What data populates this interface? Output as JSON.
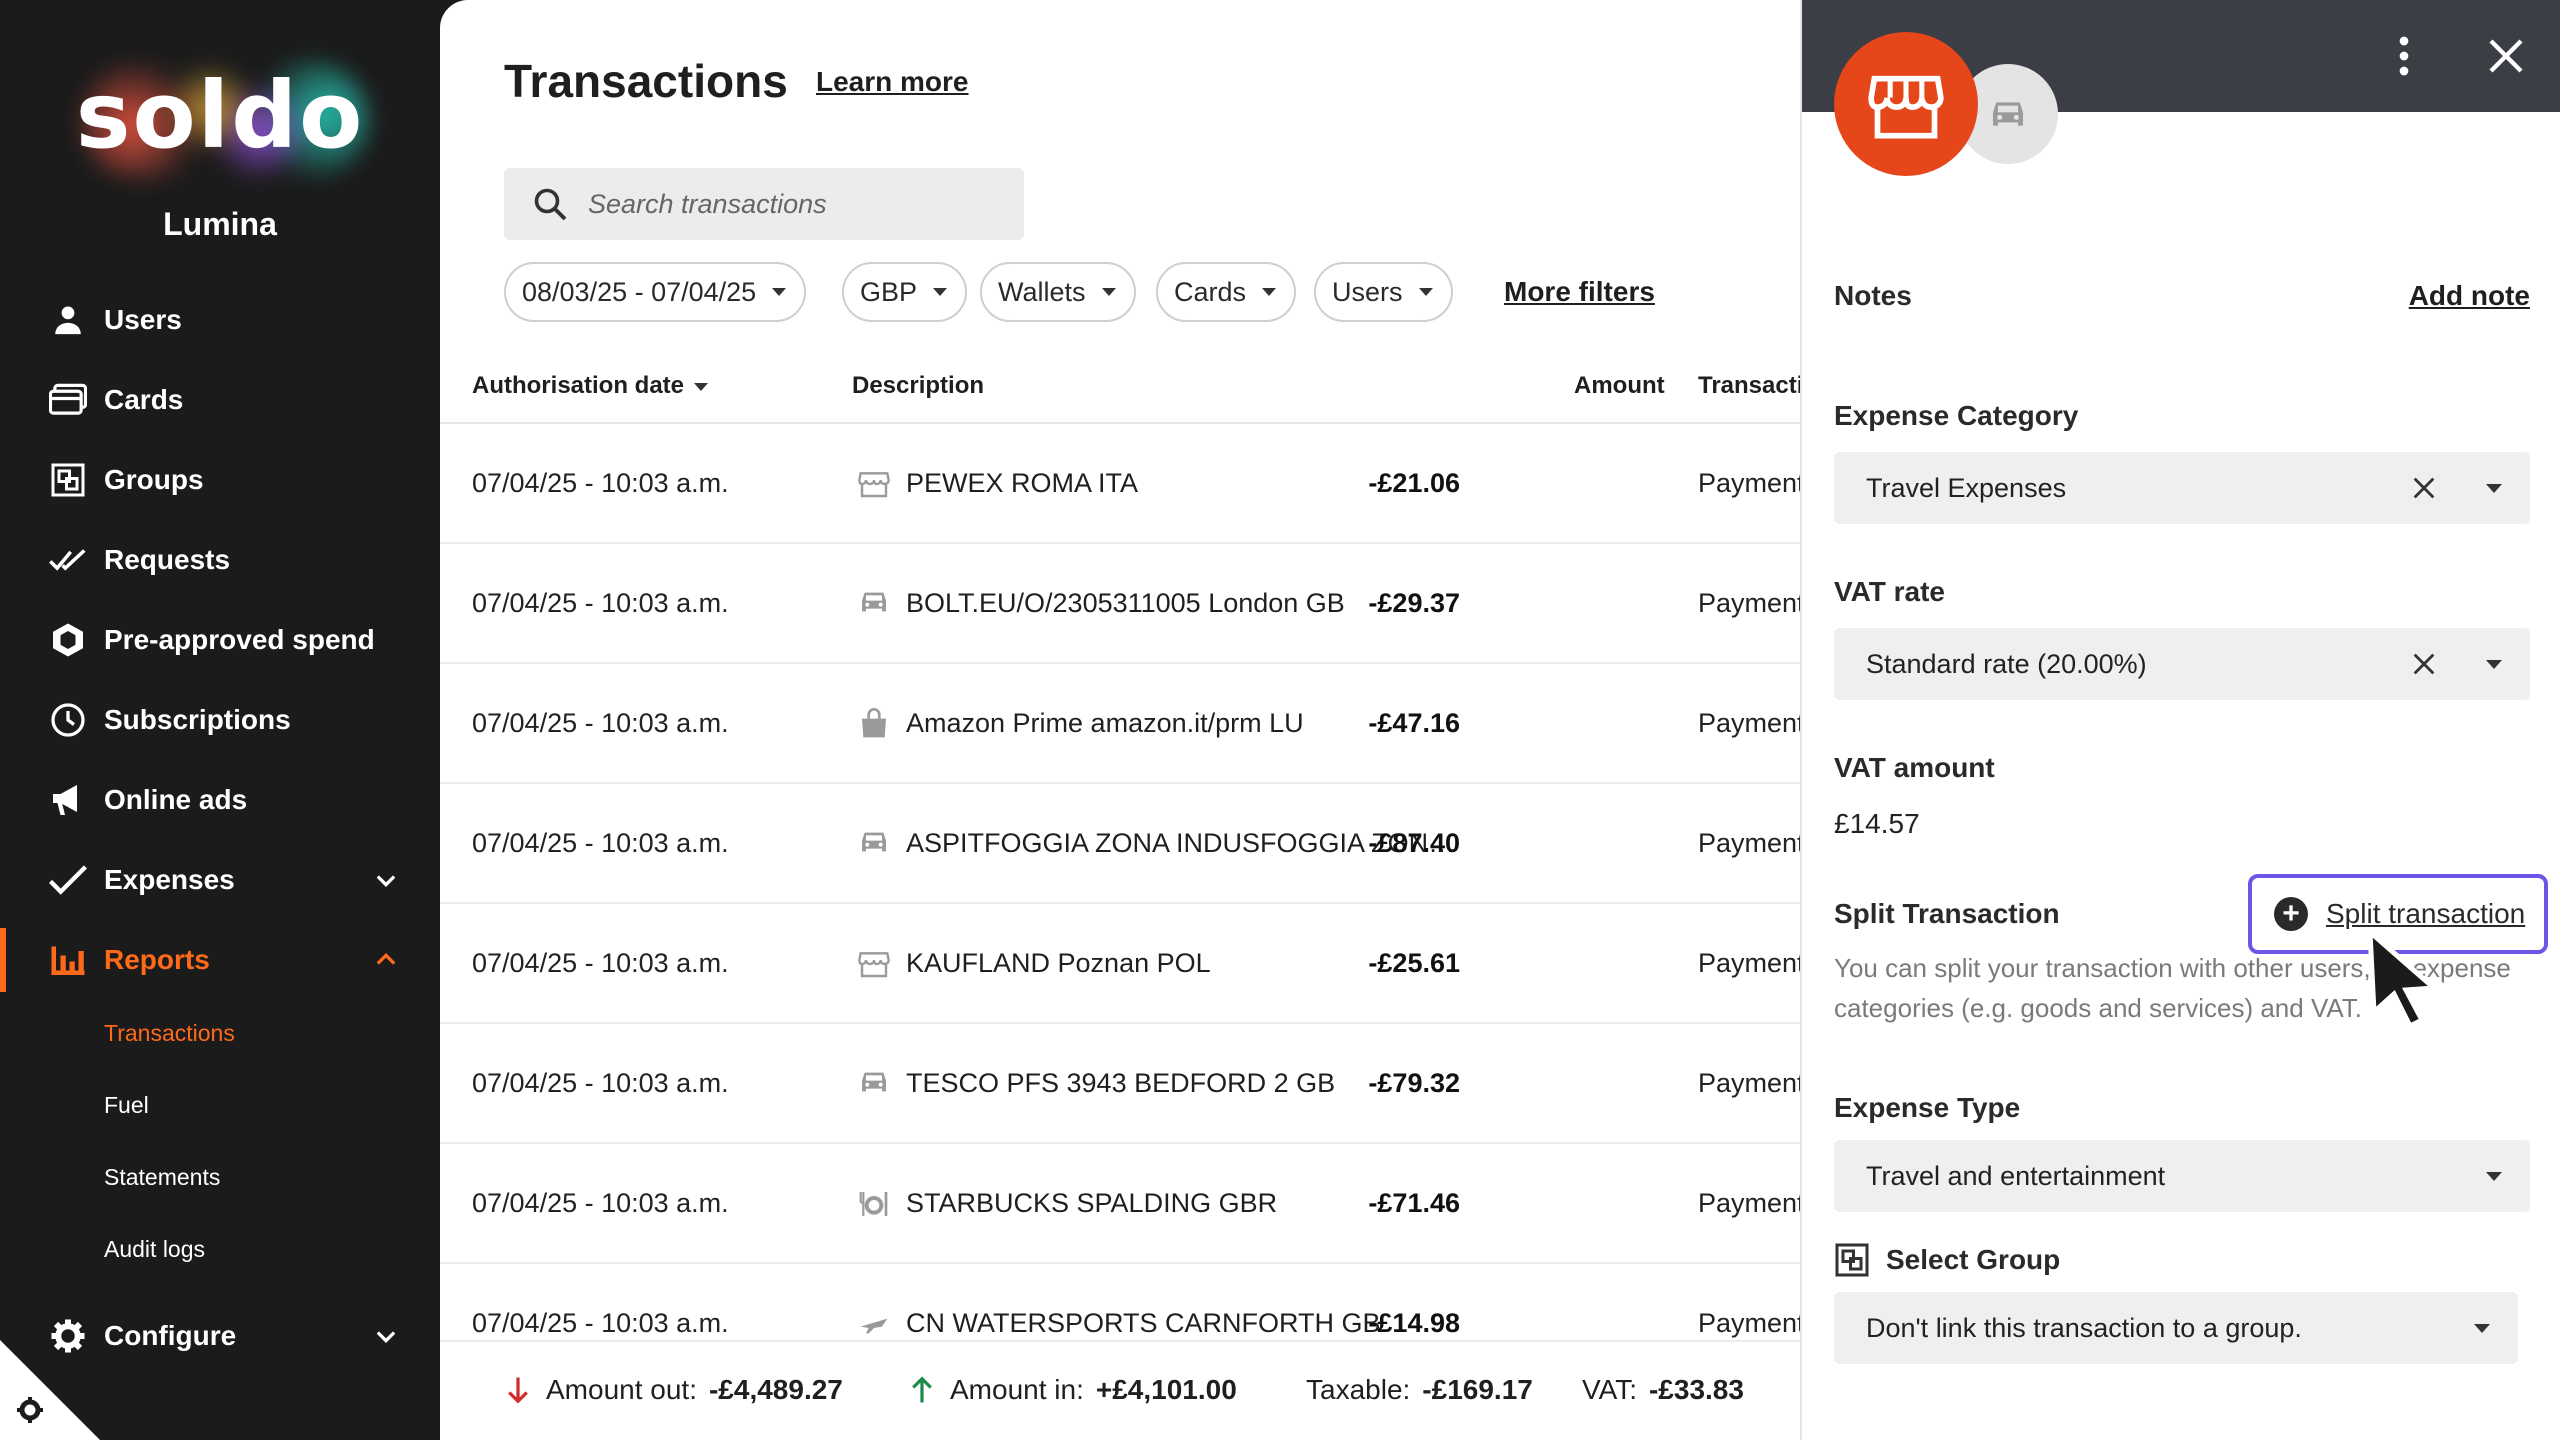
{
  "sidebar": {
    "logo_text": "soldo",
    "company": "Lumina",
    "items": [
      {
        "label": "Users",
        "icon": "user-icon"
      },
      {
        "label": "Cards",
        "icon": "card-icon"
      },
      {
        "label": "Groups",
        "icon": "groups-icon"
      },
      {
        "label": "Requests",
        "icon": "double-check-icon"
      },
      {
        "label": "Pre-approved spend",
        "icon": "hexagon-check-icon"
      },
      {
        "label": "Subscriptions",
        "icon": "clock-icon"
      },
      {
        "label": "Online ads",
        "icon": "megaphone-icon"
      },
      {
        "label": "Expenses",
        "icon": "check-icon"
      },
      {
        "label": "Reports",
        "icon": "bar-chart-icon"
      },
      {
        "label": "Configure",
        "icon": "gear-icon"
      }
    ],
    "report_subitems": [
      "Transactions",
      "Fuel",
      "Statements",
      "Audit logs"
    ],
    "accent": "#ff6a1a"
  },
  "main": {
    "title": "Transactions",
    "learn_more": "Learn more",
    "search_placeholder": "Search transactions",
    "filters": {
      "date_range": "08/03/25 - 07/04/25",
      "currency": "GBP",
      "wallets": "Wallets",
      "cards": "Cards",
      "users": "Users",
      "more": "More filters"
    },
    "columns": {
      "date": "Authorisation date",
      "description": "Description",
      "amount": "Amount",
      "type": "Transacti"
    },
    "rows": [
      {
        "date": "07/04/25 - 10:03 a.m.",
        "icon": "store-icon",
        "description": "PEWEX ROMA ITA",
        "amount": "-£21.06",
        "type": "Payment"
      },
      {
        "date": "07/04/25 - 10:03 a.m.",
        "icon": "car-icon",
        "description": "BOLT.EU/O/2305311005 London GB",
        "amount": "-£29.37",
        "type": "Payment"
      },
      {
        "date": "07/04/25 - 10:03 a.m.",
        "icon": "shopping-bag-icon",
        "description": "Amazon Prime amazon.it/prm LU",
        "amount": "-£47.16",
        "type": "Payment"
      },
      {
        "date": "07/04/25 - 10:03 a.m.",
        "icon": "car-icon",
        "description": "ASPITFOGGIA ZONA INDUSFOGGIA ZONA ...",
        "amount": "-£87.40",
        "type": "Payment"
      },
      {
        "date": "07/04/25 - 10:03 a.m.",
        "icon": "store-icon",
        "description": "KAUFLAND Poznan POL",
        "amount": "-£25.61",
        "type": "Payment"
      },
      {
        "date": "07/04/25 - 10:03 a.m.",
        "icon": "car-icon",
        "description": "TESCO PFS 3943 BEDFORD 2 GB",
        "amount": "-£79.32",
        "type": "Payment"
      },
      {
        "date": "07/04/25 - 10:03 a.m.",
        "icon": "restaurant-icon",
        "description": "STARBUCKS SPALDING GBR",
        "amount": "-£71.46",
        "type": "Payment"
      },
      {
        "date": "07/04/25 - 10:03 a.m.",
        "icon": "plane-icon",
        "description": "CN WATERSPORTS CARNFORTH GB",
        "amount": "-£14.98",
        "type": "Payment"
      }
    ],
    "footer": {
      "out_label": "Amount out:",
      "out_value": "-£4,489.27",
      "in_label": "Amount in:",
      "in_value": "+£4,101.00",
      "taxable_label": "Taxable:",
      "taxable_value": "-£169.17",
      "vat_label": "VAT:",
      "vat_value": "-£33.83"
    }
  },
  "panel": {
    "notes_label": "Notes",
    "add_note": "Add note",
    "expense_category_label": "Expense Category",
    "expense_category_value": "Travel Expenses",
    "vat_rate_label": "VAT rate",
    "vat_rate_value": "Standard rate (20.00%)",
    "vat_amount_label": "VAT amount",
    "vat_amount_value": "£14.57",
    "split_label": "Split Transaction",
    "split_button": "Split transaction",
    "split_help": "You can split your transaction with other users, by expense categories (e.g. goods and services) and VAT.",
    "expense_type_label": "Expense Type",
    "expense_type_value": "Travel and entertainment",
    "select_group_label": "Select Group",
    "select_group_value": "Don't link this transaction to a group.",
    "merchant_color": "#e5461a",
    "highlight_color": "#6a57e8"
  }
}
